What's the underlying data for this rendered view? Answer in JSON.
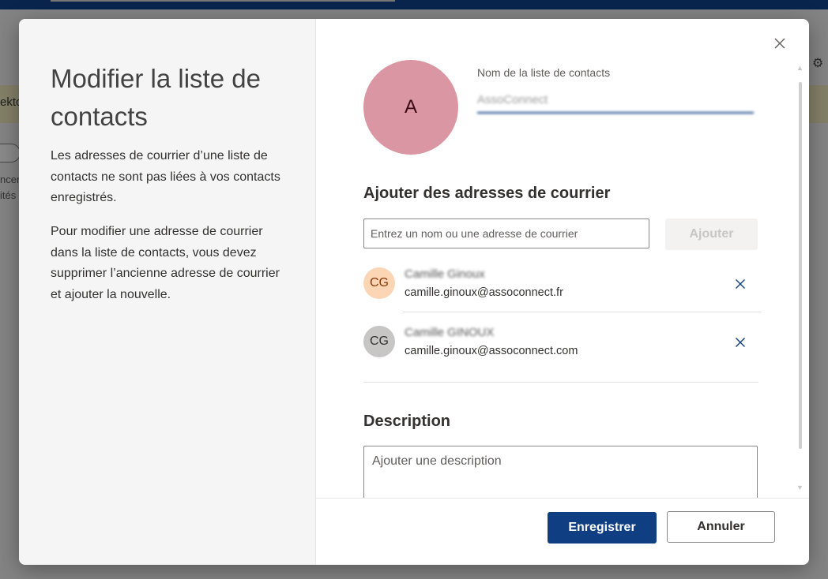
{
  "background": {
    "left_text": "ekto",
    "left_text2": "ncer",
    "left_text3": "ités"
  },
  "dialog": {
    "title": "Modifier la liste de contacts",
    "left_paragraphs": [
      "Les adresses de courrier d’une liste de contacts ne sont pas liées à vos contacts enregistrés.",
      "Pour modifier une adresse de courrier dans la liste de contacts, vous devez supprimer l’ancienne adresse de courrier et ajouter la nouvelle."
    ],
    "avatar_initial": "A",
    "avatar_color": "#da97a3",
    "name_label": "Nom de la liste de contacts",
    "name_value": "AssoConnect",
    "add_section_title": "Ajouter des adresses de courrier",
    "add_placeholder": "Entrez un nom ou une adresse de courrier",
    "add_button": "Ajouter",
    "contacts": [
      {
        "initials": "CG",
        "name": "Camille Ginoux",
        "email": "camille.ginoux@assoconnect.fr",
        "avatar_color": "#fcd5b4"
      },
      {
        "initials": "CG",
        "name": "Camille GINOUX",
        "email": "camille.ginoux@assoconnect.com",
        "avatar_color": "#c8c6c4"
      }
    ],
    "description_title": "Description",
    "description_placeholder": "Ajouter une description",
    "save_button": "Enregistrer",
    "cancel_button": "Annuler"
  },
  "colors": {
    "primary": "#0f3e83",
    "topbar": "#0f3e83"
  }
}
